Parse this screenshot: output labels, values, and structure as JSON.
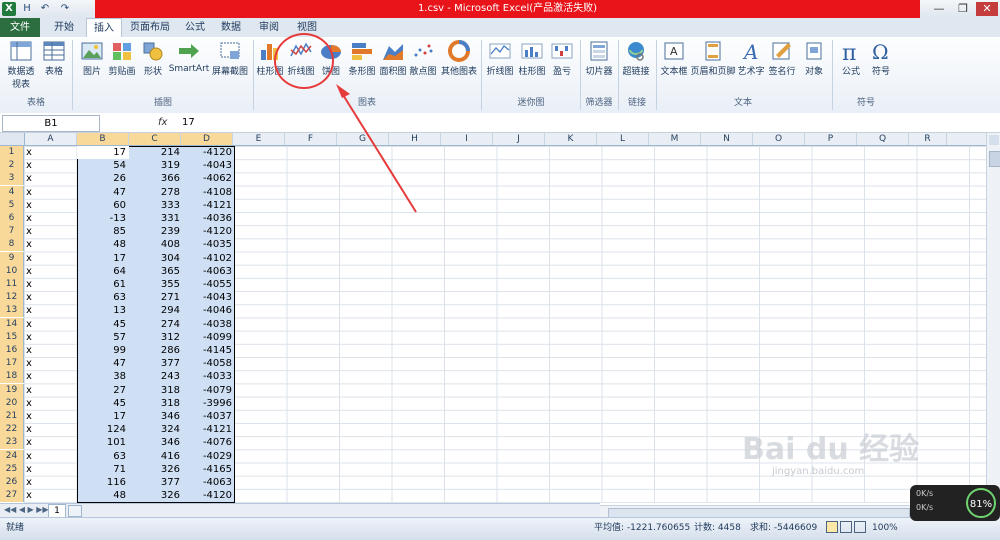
{
  "window": {
    "title": "1.csv  -  Microsoft Excel(产品激活失败)",
    "qa_save": "H",
    "qa_undo": "↶",
    "qa_redo": "↷",
    "app_icon": "X",
    "minimize": "—",
    "restore": "❐",
    "close": "✕"
  },
  "tabs": [
    "文件",
    "开始",
    "插入",
    "页面布局",
    "公式",
    "数据",
    "审阅",
    "视图"
  ],
  "ribbon": {
    "items": [
      {
        "label": "数据透视表",
        "icon": "pivot-table-icon"
      },
      {
        "label": "表格",
        "icon": "table-icon"
      },
      {
        "label": "图片",
        "icon": "picture-icon"
      },
      {
        "label": "剪贴画",
        "icon": "clipart-icon"
      },
      {
        "label": "形状",
        "icon": "shapes-icon"
      },
      {
        "label": "SmartArt",
        "icon": "smartart-icon"
      },
      {
        "label": "屏幕截图",
        "icon": "screenshot-icon"
      },
      {
        "label": "柱形图",
        "icon": "column-chart-icon"
      },
      {
        "label": "折线图",
        "icon": "line-chart-icon"
      },
      {
        "label": "饼图",
        "icon": "pie-chart-icon"
      },
      {
        "label": "条形图",
        "icon": "bar-chart-icon"
      },
      {
        "label": "面积图",
        "icon": "area-chart-icon"
      },
      {
        "label": "散点图",
        "icon": "scatter-chart-icon"
      },
      {
        "label": "其他图表",
        "icon": "other-charts-icon"
      },
      {
        "label": "折线图",
        "icon": "sparkline-line-icon"
      },
      {
        "label": "柱形图",
        "icon": "sparkline-column-icon"
      },
      {
        "label": "盈亏",
        "icon": "sparkline-winloss-icon"
      },
      {
        "label": "切片器",
        "icon": "slicer-icon"
      },
      {
        "label": "超链接",
        "icon": "hyperlink-icon"
      },
      {
        "label": "文本框",
        "icon": "textbox-icon"
      },
      {
        "label": "页眉和页脚",
        "icon": "header-footer-icon"
      },
      {
        "label": "艺术字",
        "icon": "wordart-icon"
      },
      {
        "label": "签名行",
        "icon": "signature-icon"
      },
      {
        "label": "对象",
        "icon": "object-icon"
      },
      {
        "label": "公式",
        "icon": "equation-icon"
      },
      {
        "label": "符号",
        "icon": "symbol-icon"
      }
    ],
    "groups": [
      "表格",
      "插图",
      "图表",
      "迷你图",
      "筛选器",
      "链接",
      "文本",
      "符号"
    ]
  },
  "formula": {
    "namebox": "B1",
    "fx": "fx",
    "content": "17"
  },
  "columns": [
    "A",
    "B",
    "C",
    "D",
    "E",
    "F",
    "G",
    "H",
    "I",
    "J",
    "K",
    "L",
    "M",
    "N",
    "O",
    "P",
    "Q",
    "R"
  ],
  "rows": [
    {
      "n": "1",
      "a": "x",
      "b": "17",
      "c": "214",
      "d": "-4120"
    },
    {
      "n": "2",
      "a": "x",
      "b": "54",
      "c": "319",
      "d": "-4043"
    },
    {
      "n": "3",
      "a": "x",
      "b": "26",
      "c": "366",
      "d": "-4062"
    },
    {
      "n": "4",
      "a": "x",
      "b": "47",
      "c": "278",
      "d": "-4108"
    },
    {
      "n": "5",
      "a": "x",
      "b": "60",
      "c": "333",
      "d": "-4121"
    },
    {
      "n": "6",
      "a": "x",
      "b": "-13",
      "c": "331",
      "d": "-4036"
    },
    {
      "n": "7",
      "a": "x",
      "b": "85",
      "c": "239",
      "d": "-4120"
    },
    {
      "n": "8",
      "a": "x",
      "b": "48",
      "c": "408",
      "d": "-4035"
    },
    {
      "n": "9",
      "a": "x",
      "b": "17",
      "c": "304",
      "d": "-4102"
    },
    {
      "n": "10",
      "a": "x",
      "b": "64",
      "c": "365",
      "d": "-4063"
    },
    {
      "n": "11",
      "a": "x",
      "b": "61",
      "c": "355",
      "d": "-4055"
    },
    {
      "n": "12",
      "a": "x",
      "b": "63",
      "c": "271",
      "d": "-4043"
    },
    {
      "n": "13",
      "a": "x",
      "b": "13",
      "c": "294",
      "d": "-4046"
    },
    {
      "n": "14",
      "a": "x",
      "b": "45",
      "c": "274",
      "d": "-4038"
    },
    {
      "n": "15",
      "a": "x",
      "b": "57",
      "c": "312",
      "d": "-4099"
    },
    {
      "n": "16",
      "a": "x",
      "b": "99",
      "c": "286",
      "d": "-4145"
    },
    {
      "n": "17",
      "a": "x",
      "b": "47",
      "c": "377",
      "d": "-4058"
    },
    {
      "n": "18",
      "a": "x",
      "b": "38",
      "c": "243",
      "d": "-4033"
    },
    {
      "n": "19",
      "a": "x",
      "b": "27",
      "c": "318",
      "d": "-4079"
    },
    {
      "n": "20",
      "a": "x",
      "b": "45",
      "c": "318",
      "d": "-3996"
    },
    {
      "n": "21",
      "a": "x",
      "b": "17",
      "c": "346",
      "d": "-4037"
    },
    {
      "n": "22",
      "a": "x",
      "b": "124",
      "c": "324",
      "d": "-4121"
    },
    {
      "n": "23",
      "a": "x",
      "b": "101",
      "c": "346",
      "d": "-4076"
    },
    {
      "n": "24",
      "a": "x",
      "b": "63",
      "c": "416",
      "d": "-4029"
    },
    {
      "n": "25",
      "a": "x",
      "b": "71",
      "c": "326",
      "d": "-4165"
    },
    {
      "n": "26",
      "a": "x",
      "b": "116",
      "c": "377",
      "d": "-4063"
    },
    {
      "n": "27",
      "a": "x",
      "b": "48",
      "c": "326",
      "d": "-4120"
    }
  ],
  "sheet": {
    "tab": "1"
  },
  "status": {
    "ready": "就绪",
    "average": "平均值: -1221.760655",
    "count": "计数: 4458",
    "sum": "求和: -5446609",
    "zoom": "100%"
  },
  "watermark": {
    "main": "Bai du 经验",
    "sub": "jingyan.baidu.com"
  },
  "network": {
    "percent": "81%",
    "up": "0K/s",
    "down": "0K/s"
  },
  "colors": {
    "title_bar": "#e8141a",
    "file_tab": "#2c6e3f",
    "selection": "#cfe0f5",
    "annotation": "#e63b3b"
  }
}
